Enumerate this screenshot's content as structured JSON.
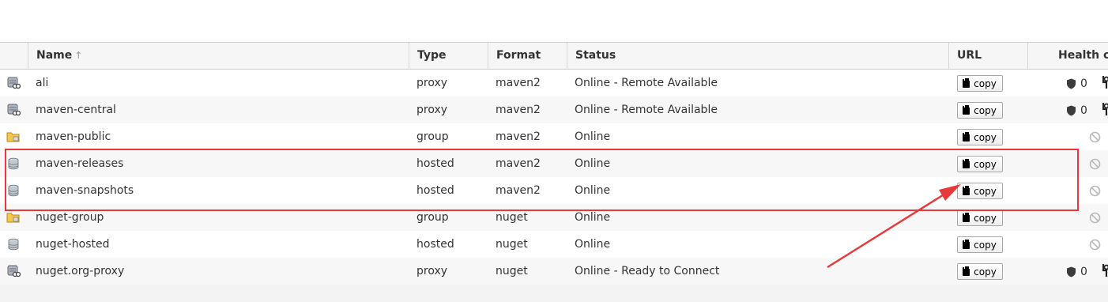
{
  "table": {
    "columns": [
      {
        "label": "Name",
        "sort": "↑"
      },
      {
        "label": "Type"
      },
      {
        "label": "Format"
      },
      {
        "label": "Status"
      },
      {
        "label": "URL"
      },
      {
        "label": "Health ch"
      }
    ],
    "copy_label": "copy",
    "rows": [
      {
        "icon": "proxy-repository-icon",
        "name": "ali",
        "type": "proxy",
        "format": "maven2",
        "status": "Online - Remote Available",
        "health": "0"
      },
      {
        "icon": "proxy-repository-icon",
        "name": "maven-central",
        "type": "proxy",
        "format": "maven2",
        "status": "Online - Remote Available",
        "health": "0"
      },
      {
        "icon": "group-repository-icon",
        "name": "maven-public",
        "type": "group",
        "format": "maven2",
        "status": "Online",
        "health": null
      },
      {
        "icon": "hosted-repository-icon",
        "name": "maven-releases",
        "type": "hosted",
        "format": "maven2",
        "status": "Online",
        "health": null
      },
      {
        "icon": "hosted-repository-icon",
        "name": "maven-snapshots",
        "type": "hosted",
        "format": "maven2",
        "status": "Online",
        "health": null
      },
      {
        "icon": "group-repository-icon",
        "name": "nuget-group",
        "type": "group",
        "format": "nuget",
        "status": "Online",
        "health": null
      },
      {
        "icon": "hosted-repository-icon",
        "name": "nuget-hosted",
        "type": "hosted",
        "format": "nuget",
        "status": "Online",
        "health": null
      },
      {
        "icon": "proxy-repository-icon",
        "name": "nuget.org-proxy",
        "type": "proxy",
        "format": "nuget",
        "status": "Online - Ready to Connect",
        "health": "0"
      }
    ]
  },
  "colors": {
    "annotation": "#e8393a",
    "header_bg": "#f6f6f6",
    "row_alt_bg": "#f7f7f7"
  }
}
